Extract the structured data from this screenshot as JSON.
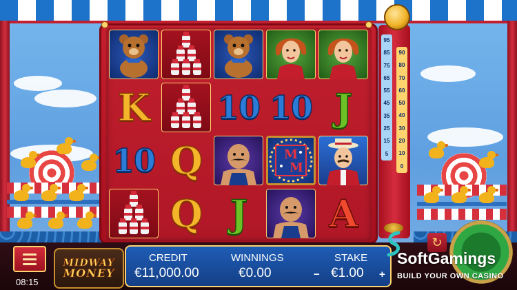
{
  "game": {
    "logo_line1": "MIDWAY",
    "logo_line2": "MONEY",
    "clock": "08:15"
  },
  "reels": {
    "rows": [
      [
        {
          "symbol": "teddy-bear"
        },
        {
          "symbol": "milk-bottles"
        },
        {
          "symbol": "teddy-bear"
        },
        {
          "symbol": "woman"
        },
        {
          "symbol": "woman"
        }
      ],
      [
        {
          "symbol": "K",
          "color": "gold"
        },
        {
          "symbol": "milk-bottles"
        },
        {
          "symbol": "10",
          "color": "blue"
        },
        {
          "symbol": "10",
          "color": "blue"
        },
        {
          "symbol": "J",
          "color": "green"
        }
      ],
      [
        {
          "symbol": "10",
          "color": "blue"
        },
        {
          "symbol": "Q",
          "color": "gold"
        },
        {
          "symbol": "strongman"
        },
        {
          "symbol": "midway-money-wild"
        },
        {
          "symbol": "ringmaster"
        }
      ],
      [
        {
          "symbol": "milk-bottles"
        },
        {
          "symbol": "Q",
          "color": "gold"
        },
        {
          "symbol": "J",
          "color": "green"
        },
        {
          "symbol": "strongman"
        },
        {
          "symbol": "A",
          "color": "red"
        }
      ]
    ]
  },
  "tester": {
    "left_scale": [
      "95",
      "85",
      "75",
      "65",
      "55",
      "45",
      "35",
      "25",
      "15",
      "5"
    ],
    "right_scale": [
      "90",
      "80",
      "70",
      "60",
      "50",
      "40",
      "30",
      "20",
      "10",
      "0"
    ]
  },
  "hud": {
    "credit_label": "CREDIT",
    "credit_value": "€11,000.00",
    "winnings_label": "WINNINGS",
    "winnings_value": "€0.00",
    "stake_label": "STAKE",
    "stake_value": "€1.00",
    "stake_minus": "−",
    "stake_plus": "+"
  },
  "watermark": {
    "title": "SoftGamings",
    "subtitle": "BUILD YOUR OWN CASINO"
  },
  "colors": {
    "frame_red": "#b01727",
    "panel_blue": "#1f5db6",
    "gold": "#ffd36d",
    "spin_green": "#2fa844"
  }
}
